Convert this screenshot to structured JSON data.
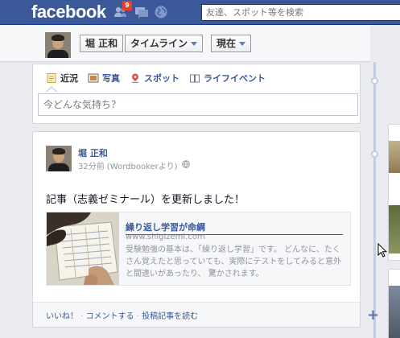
{
  "topbar": {
    "logo": "facebook",
    "friend_requests_badge": "9",
    "search_placeholder": "友達、スポット等を検索",
    "bar_color": "#3b5998"
  },
  "timeline_header": {
    "name": "堀 正和",
    "timeline_label": "タイムライン",
    "period_label": "現在"
  },
  "composer": {
    "tabs": [
      {
        "label": "近況",
        "icon": "status-icon"
      },
      {
        "label": "写真",
        "icon": "photo-icon"
      },
      {
        "label": "スポット",
        "icon": "place-icon"
      },
      {
        "label": "ライフイベント",
        "icon": "life-event-icon"
      }
    ],
    "placeholder": "今どんな気持ち？"
  },
  "post": {
    "author": "堀 正和",
    "meta": "32分前 (Wordbookerより)",
    "text": "記事（志義ゼミナール）を更新しました！",
    "attachment": {
      "title": "繰り返し学習が命綱",
      "url": "www.shigizemi.com",
      "description": "受験勉強の基本は、「繰り返し学習」です。 どんなに、たくさん覚えたと思っていても、実際にテストをしてみると意外と間違いがあったり、 驚かされます。"
    },
    "actions": {
      "like": "いいね！",
      "sep1": " · ",
      "comment": "コメントする",
      "sep2": " · ",
      "read": "投稿記事を読む"
    }
  }
}
